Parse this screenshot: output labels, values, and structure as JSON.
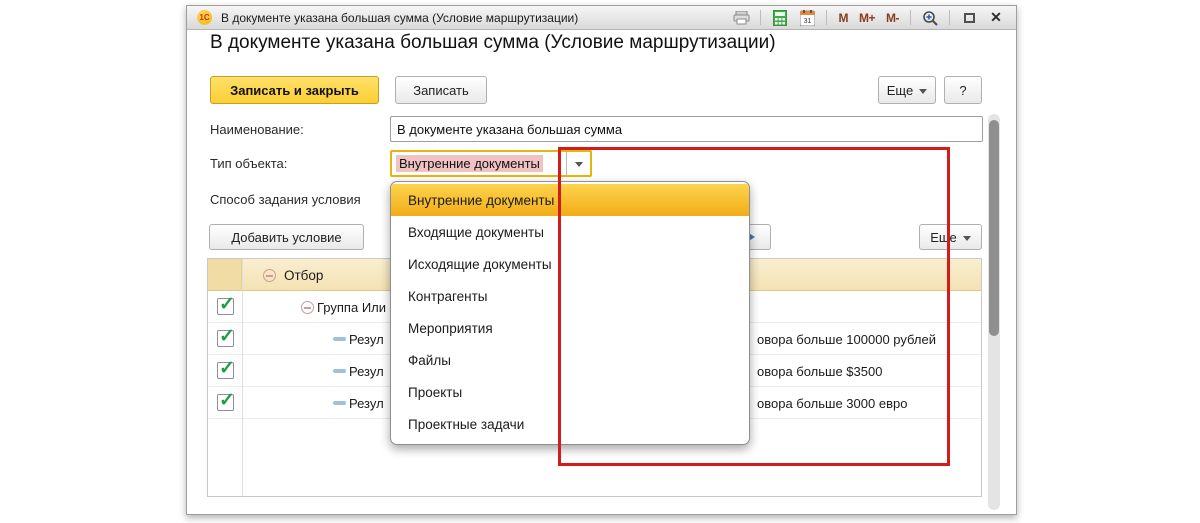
{
  "window": {
    "title": "В документе указана большая сумма (Условие маршрутизации)",
    "logo_text": "1С",
    "titlebar_buttons": {
      "m": "M",
      "m_plus": "M+",
      "m_minus": "M-",
      "close": "✕"
    }
  },
  "page": {
    "heading": "В документе указана большая сумма (Условие маршрутизации)"
  },
  "toolbar": {
    "save_close_label": "Записать и закрыть",
    "save_label": "Записать",
    "more_label": "Еще",
    "help_label": "?"
  },
  "form": {
    "name_label": "Наименование:",
    "name_value": "В документе указана большая сумма",
    "type_label": "Тип объекта:",
    "type_value": "Внутренние документы",
    "method_label": "Способ задания условия"
  },
  "dropdown": {
    "items": [
      "Внутренние документы",
      "Входящие документы",
      "Исходящие документы",
      "Контрагенты",
      "Мероприятия",
      "Файлы",
      "Проекты",
      "Проектные задачи"
    ],
    "selected": "Внутренние документы"
  },
  "conditions": {
    "add_button_label": "Добавить условие",
    "more_label": "Еще",
    "table": {
      "header": "Отбор",
      "rows": [
        {
          "checked": true,
          "label": "Группа Или",
          "right": ""
        },
        {
          "checked": true,
          "label": "Резул",
          "right": "овора больше 100000 рублей"
        },
        {
          "checked": true,
          "label": "Резул",
          "right": "овора больше $3500"
        },
        {
          "checked": true,
          "label": "Резул",
          "right": "овора больше 3000 евро"
        }
      ]
    }
  },
  "colors": {
    "accent_yellow": "#fbce33",
    "annotation_red": "#d41b1b",
    "selection_pink": "#f0c2c3",
    "highlight_yellow": "#f2ac17",
    "check_green": "#1f9d44",
    "header_beige": "#f4e2b4"
  }
}
